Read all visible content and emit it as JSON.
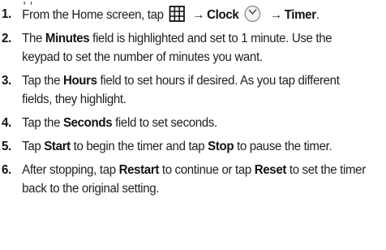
{
  "header_fragment": ", ,",
  "steps": [
    {
      "num": "1.",
      "t1": "From the Home screen, tap",
      "arrow1": "→",
      "clock_label": "Clock",
      "arrow2": "→",
      "timer_label": "Timer",
      "t_end": "."
    },
    {
      "num": "2.",
      "t1": "The ",
      "b1": "Minutes",
      "t2": " field is highlighted and set to 1 minute. Use the keypad to set the number of minutes you want."
    },
    {
      "num": "3.",
      "t1": "Tap the ",
      "b1": "Hours",
      "t2": " field to set hours if desired. As you tap different fields, they highlight."
    },
    {
      "num": "4.",
      "t1": "Tap the ",
      "b1": "Seconds",
      "t2": " field to set seconds."
    },
    {
      "num": "5.",
      "t1": "Tap ",
      "b1": "Start",
      "t2": " to begin the timer and tap ",
      "b2": "Stop",
      "t3": " to pause the timer."
    },
    {
      "num": "6.",
      "t1": "After stopping, tap ",
      "b1": "Restart",
      "t2": " to continue or tap ",
      "b2": "Reset",
      "t3": " to set the timer back to the original setting."
    }
  ],
  "icons": [
    "apps-grid-icon",
    "clock-icon"
  ]
}
